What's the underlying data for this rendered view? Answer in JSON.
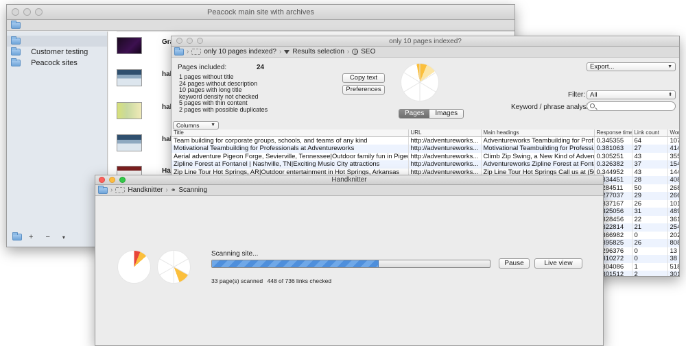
{
  "colors": {
    "accent": "#4e8fdc",
    "pie_orange": "#fbbf3c",
    "pie_red": "#e8463a"
  },
  "window1": {
    "title": "Peacock main site with archives",
    "sidebar": {
      "items": [
        {
          "label": "",
          "icon": "folder-icon"
        },
        {
          "label": "Customer testing",
          "icon": "folder-icon"
        },
        {
          "label": "Peacock sites",
          "icon": "folder-icon"
        }
      ],
      "bottom": {
        "add": "+",
        "remove": "−",
        "menu": "▾"
      }
    },
    "rows": [
      {
        "label": "Gra"
      },
      {
        "label": "hal"
      },
      {
        "label": "hal"
      },
      {
        "label": "hal"
      },
      {
        "label": "Ha"
      }
    ]
  },
  "window2": {
    "title": "only 10 pages indexed?",
    "breadcrumb": [
      "only 10 pages indexed?",
      "Results selection",
      "SEO"
    ],
    "pages_included_label": "Pages included:",
    "pages_included_value": "24",
    "stats": [
      "1 pages without title",
      "24 pages without description",
      "10 pages with long title",
      "keyword density not checked",
      "5 pages with thin content",
      "2 pages with possible duplicates"
    ],
    "copy_text_button": "Copy text",
    "preferences_button": "Preferences",
    "tabs": [
      "Pages",
      "Images"
    ],
    "export_label": "Export...",
    "filter_label": "Filter:",
    "filter_value": "All",
    "keyword_label": "Keyword / phrase analysis:",
    "columns_label": "Columns",
    "table": {
      "headers": [
        "Title",
        "URL",
        "Main headings",
        "Response time",
        "Link count",
        "Word"
      ],
      "rows": [
        [
          "Team building for corporate groups, schools, and teams of any kind",
          "http://adventureworks...",
          "Adventureworks Teambuilding for Prof...",
          "0.345355",
          "64",
          "107"
        ],
        [
          "Motivational Teambuilding for Professionals at Adventureworks",
          "http://adventureworks...",
          "Motivational Teambuilding for Professi...",
          "0.381063",
          "27",
          "414"
        ],
        [
          "Aerial adventure Pigeon Forge, Sevierville, Tennessee|Outdoor family fun in Pigeon Forge",
          "http://adventureworks...",
          "Climb Zip Swing, a New Kind of Adventure",
          "0.305251",
          "43",
          "355"
        ],
        [
          "Zipline Forest at Fontanel | Nashville, TN|Exciting Music City attractions",
          "http://adventureworks...",
          "Adventureworks Zipline Forest at Fontanel",
          "0.326382",
          "37",
          "154"
        ],
        [
          "Zip Line Tour Hot Springs, AR|Outdoor entertainment in Hot Springs, Arkansas",
          "http://adventureworks...",
          "Zip Line Tour Hot Springs Call us at (50...",
          "0.344952",
          "43",
          "144"
        ],
        [
          "Adventureworks Treetop Tour Solutions",
          "http://adventureworks...",
          "Treetop Tour Solutions",
          "0.334451",
          "28",
          "408"
        ],
        [
          "",
          "",
          "",
          "0.284511",
          "50",
          "268"
        ],
        [
          "",
          "",
          "",
          "0.277037",
          "29",
          "266"
        ],
        [
          "",
          "",
          "",
          "0.337167",
          "26",
          "101"
        ],
        [
          "",
          "",
          "",
          "0.325056",
          "31",
          "489"
        ],
        [
          "",
          "",
          "",
          "0.328456",
          "22",
          "361"
        ],
        [
          "",
          "",
          "",
          "0.322814",
          "21",
          "254"
        ],
        [
          "",
          "",
          "",
          "0.366982",
          "0",
          "202"
        ],
        [
          "",
          "",
          "",
          "0.395825",
          "26",
          "808"
        ],
        [
          "",
          "",
          "",
          "0.296376",
          "0",
          "13"
        ],
        [
          "",
          "",
          "",
          "0.310272",
          "0",
          "38"
        ],
        [
          "",
          "",
          "",
          "0.304086",
          "1",
          "518"
        ],
        [
          "",
          "",
          "",
          "0.301512",
          "2",
          "301"
        ]
      ]
    }
  },
  "window3": {
    "title": "Handknitter",
    "breadcrumb": [
      "Handknitter",
      "Scanning"
    ],
    "status_text": "Scanning site...",
    "progress_fraction": 0.6,
    "pause_button": "Pause",
    "live_view_button": "Live view",
    "pages_scanned": "33 page(s) scanned",
    "links_checked": "448 of 736 links checked"
  }
}
